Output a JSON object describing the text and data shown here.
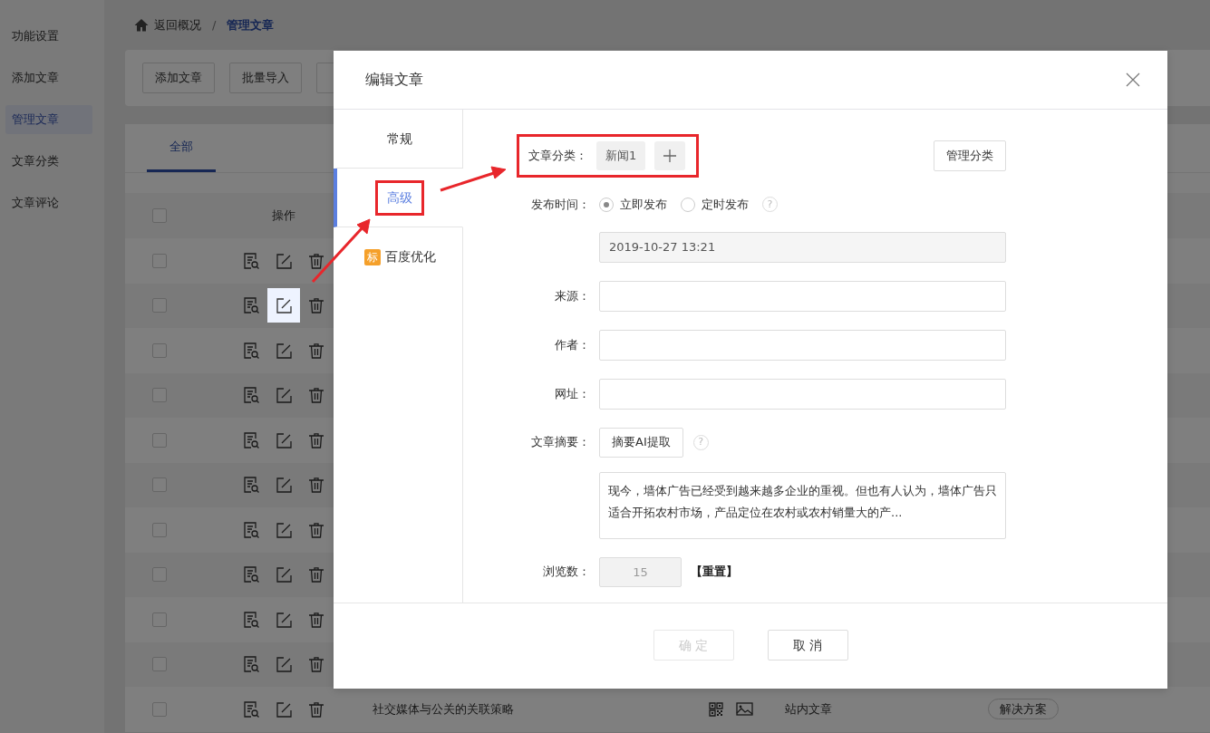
{
  "sidebar": {
    "items": [
      {
        "label": "功能设置",
        "selected": false
      },
      {
        "label": "添加文章",
        "selected": false
      },
      {
        "label": "管理文章",
        "selected": true
      },
      {
        "label": "文章分类",
        "selected": false
      },
      {
        "label": "文章评论",
        "selected": false
      }
    ]
  },
  "breadcrumb": {
    "back": "返回概况",
    "separator": "/",
    "current": "管理文章"
  },
  "toolbar": {
    "buttons": [
      "添加文章",
      "批量导入"
    ]
  },
  "tabs": [
    {
      "label": "全部",
      "selected": true
    }
  ],
  "table": {
    "header": {
      "checked": false,
      "column": "操作"
    },
    "rows": [
      {
        "checked": false,
        "edit_hovered": false
      },
      {
        "checked": false,
        "edit_hovered": true
      },
      {
        "checked": false,
        "edit_hovered": false
      },
      {
        "checked": false,
        "edit_hovered": false
      },
      {
        "checked": false,
        "edit_hovered": false
      },
      {
        "checked": false,
        "edit_hovered": false
      },
      {
        "checked": false,
        "edit_hovered": false
      },
      {
        "checked": false,
        "edit_hovered": false
      },
      {
        "checked": false,
        "edit_hovered": false
      },
      {
        "checked": false,
        "edit_hovered": false
      },
      {
        "checked": false,
        "edit_hovered": false,
        "title": "社交媒体与公关的关联策略",
        "type": "站内文章",
        "tag": "解决方案"
      }
    ]
  },
  "dialog": {
    "title": "编辑文章",
    "tabs": [
      {
        "label": "常规",
        "selected": false,
        "annotated": false
      },
      {
        "label": "高级",
        "selected": true,
        "annotated": true
      },
      {
        "label": "百度优化",
        "badge": "标",
        "selected": false,
        "annotated": false
      }
    ],
    "form": [
      {
        "kind": "category",
        "label": "文章分类：",
        "tags": [
          "新闻1"
        ],
        "annotated": true,
        "manage_button": "管理分类"
      },
      {
        "kind": "radio",
        "label": "发布时间：",
        "options": [
          {
            "label": "立即发布",
            "selected": true
          },
          {
            "label": "定时发布",
            "selected": false
          }
        ],
        "help": "?"
      },
      {
        "kind": "input",
        "value": "2019-10-27 13:21",
        "disabled": true
      },
      {
        "kind": "input",
        "label": "来源："
      },
      {
        "kind": "input",
        "label": "作者："
      },
      {
        "kind": "input",
        "label": "网址："
      },
      {
        "kind": "action",
        "label": "文章摘要：",
        "button": "摘要AI提取",
        "help": "?"
      },
      {
        "kind": "textarea",
        "value": "现今，墙体广告已经受到越来越多企业的重视。但也有人认为，墙体广告只适合开拓农村市场，产品定位在农村或农村销量大的产..."
      },
      {
        "kind": "counter",
        "label": "浏览数：",
        "value": "15",
        "disabled": true,
        "link": "【重置】"
      }
    ],
    "buttons": [
      {
        "label": "确 定",
        "disabled": true
      },
      {
        "label": "取 消",
        "disabled": false
      }
    ]
  }
}
